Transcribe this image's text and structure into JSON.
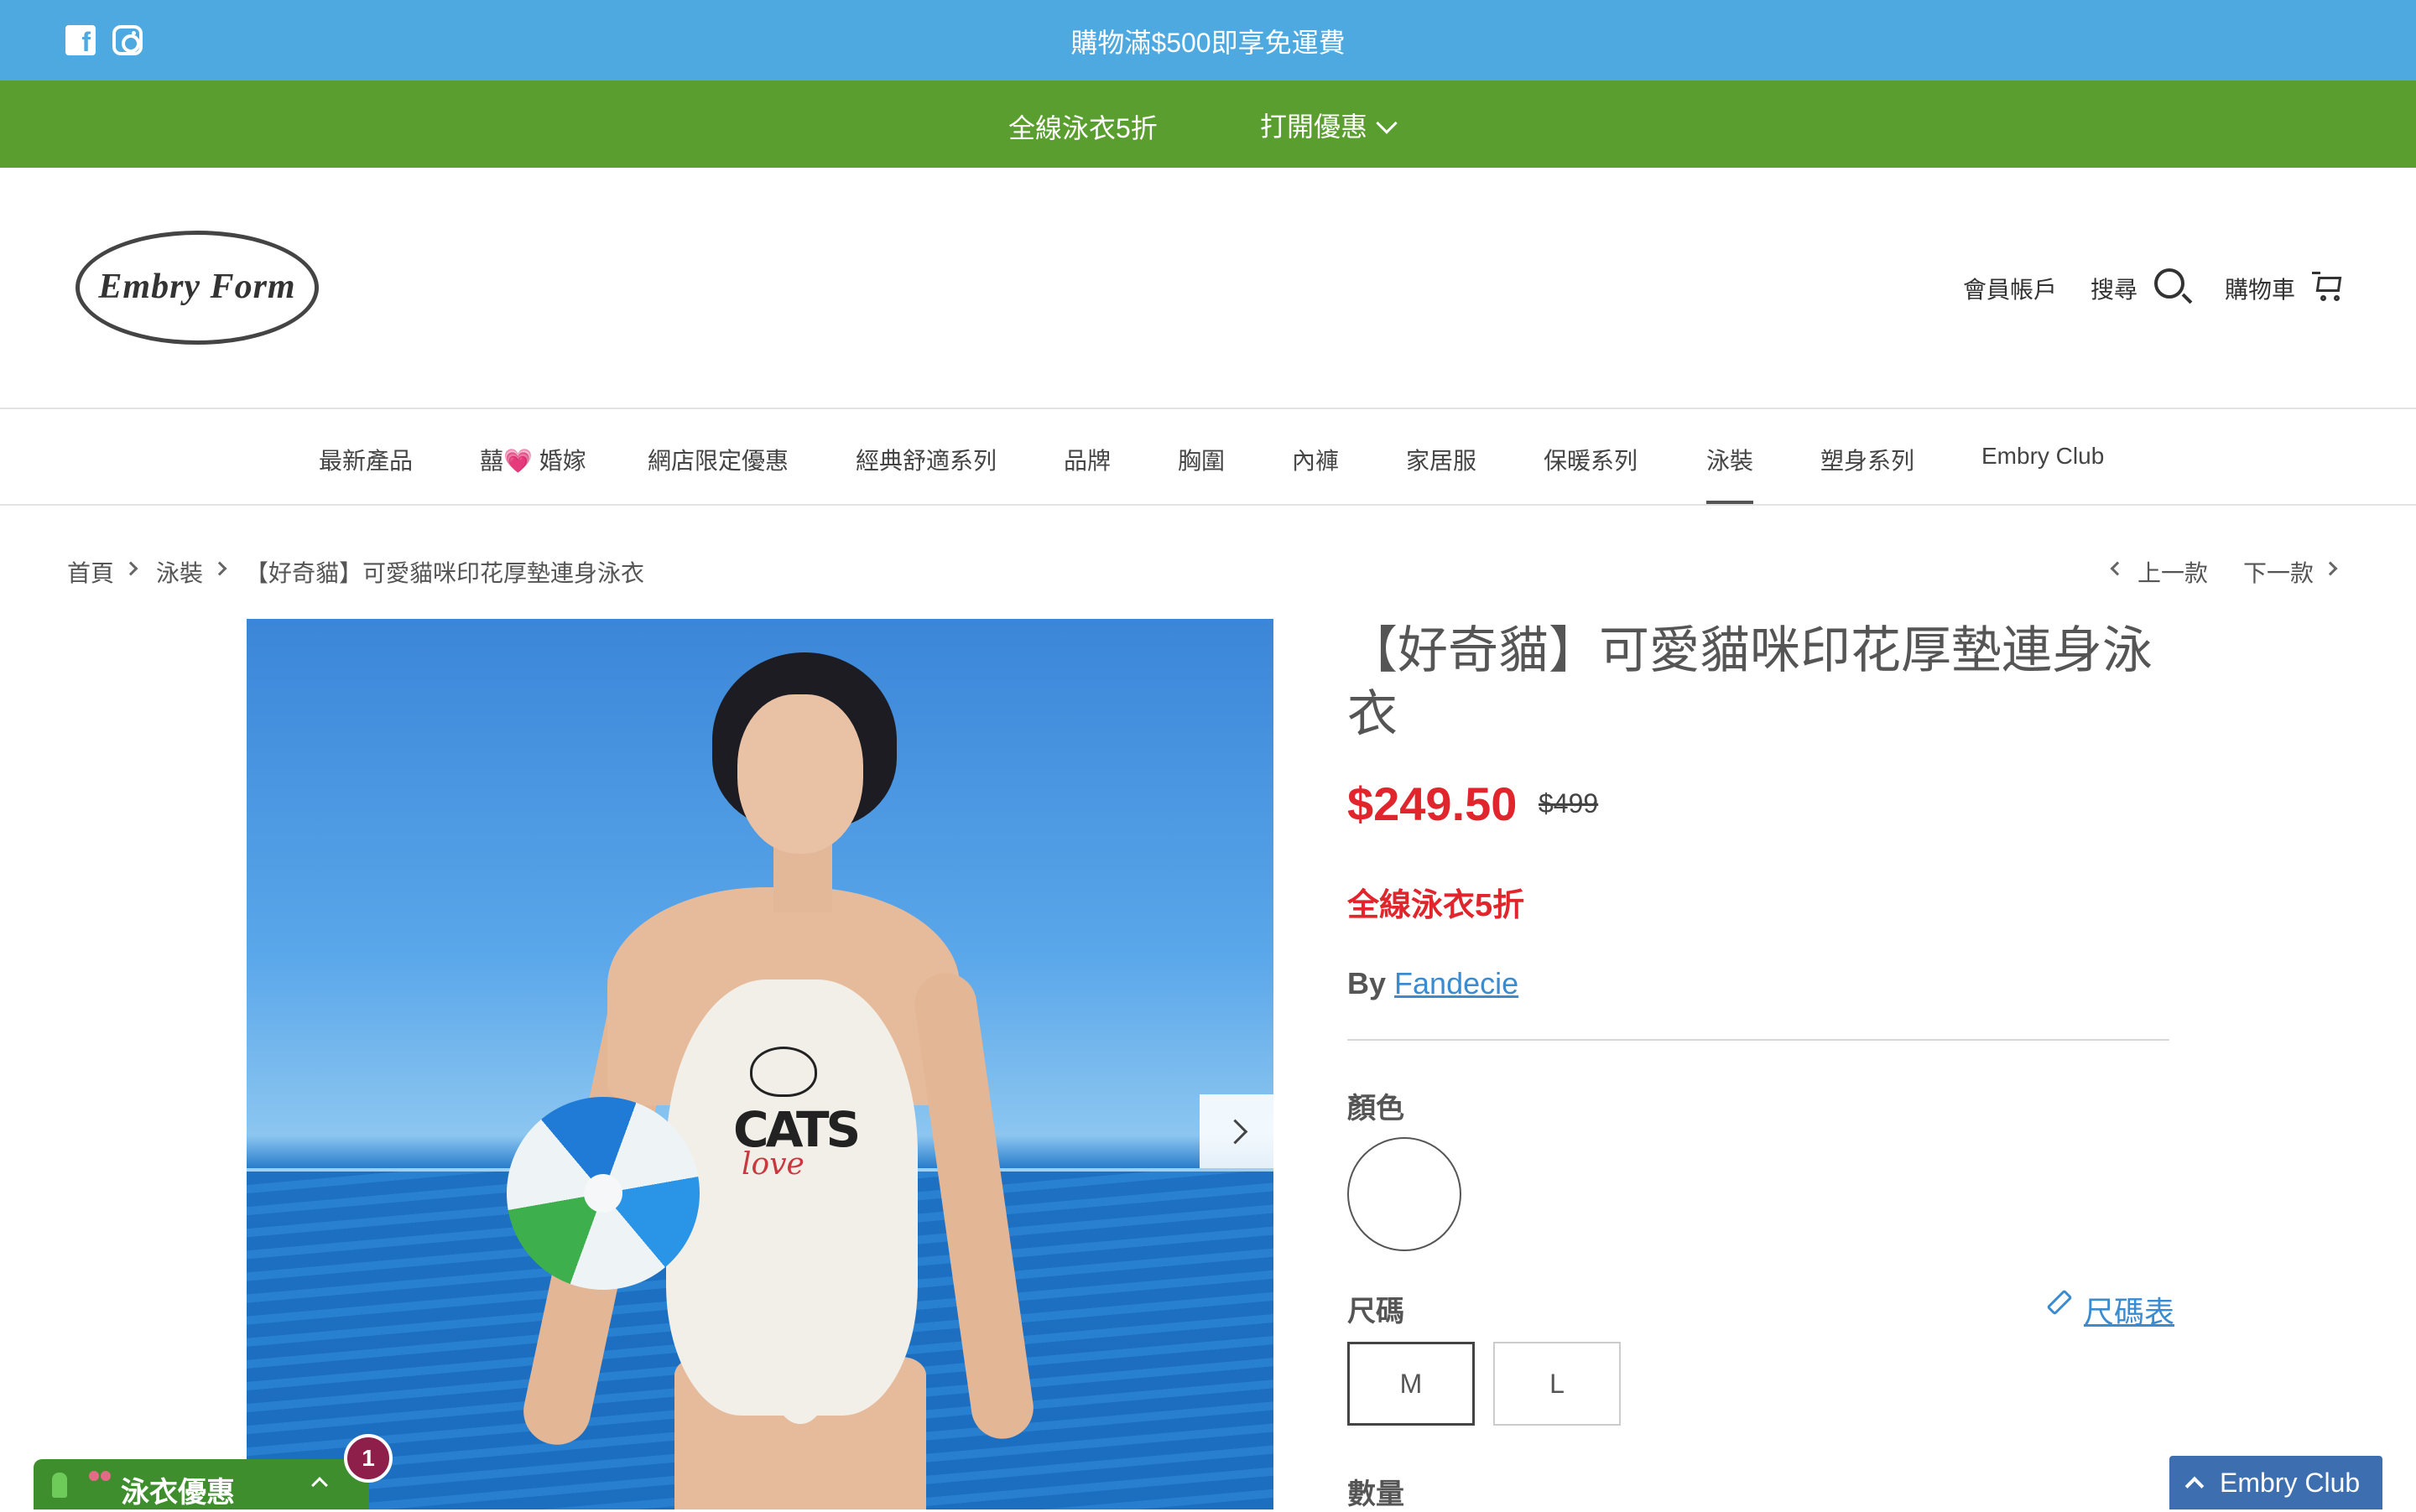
{
  "announcement": {
    "text": "購物滿$500即享免運費"
  },
  "promo_bar": {
    "offer": "全線泳衣5折",
    "toggle": "打開優惠"
  },
  "logo": {
    "text": "Embry Form"
  },
  "header": {
    "account": "會員帳戶",
    "search": "搜尋",
    "cart": "購物車"
  },
  "nav": [
    {
      "label": "最新產品"
    },
    {
      "label": "囍💗 婚嫁"
    },
    {
      "label": "網店限定優惠"
    },
    {
      "label": "經典舒適系列"
    },
    {
      "label": "品牌"
    },
    {
      "label": "胸圍"
    },
    {
      "label": "內褲"
    },
    {
      "label": "家居服"
    },
    {
      "label": "保暖系列"
    },
    {
      "label": "泳裝",
      "active": true
    },
    {
      "label": "塑身系列"
    },
    {
      "label": "Embry Club"
    }
  ],
  "breadcrumb": {
    "home": "首頁",
    "category": "泳裝",
    "current": "【好奇貓】可愛貓咪印花厚墊連身泳衣",
    "prev": "上一款",
    "next": "下一款"
  },
  "product": {
    "title": "【好奇貓】可愛貓咪印花厚墊連身泳衣",
    "price": "$249.50",
    "compare_price": "$499",
    "promo": "全線泳衣5折",
    "by_label": "By",
    "vendor": "Fandecie",
    "color_label": "顏色",
    "size_label": "尺碼",
    "size_chart": "尺碼表",
    "sizes": [
      "M",
      "L"
    ],
    "selected_size": "M",
    "qty_label": "數量",
    "image_print_text": "CATS",
    "image_print_script": "love"
  },
  "widgets": {
    "swim_tab": "泳衣優惠",
    "badge_count": "1",
    "club_button": "Embry Club"
  },
  "colors": {
    "announcement_bg": "#4ea9e0",
    "promo_bg": "#5a9e2f",
    "price_red": "#e0262c",
    "link_blue": "#3a8bd0"
  }
}
